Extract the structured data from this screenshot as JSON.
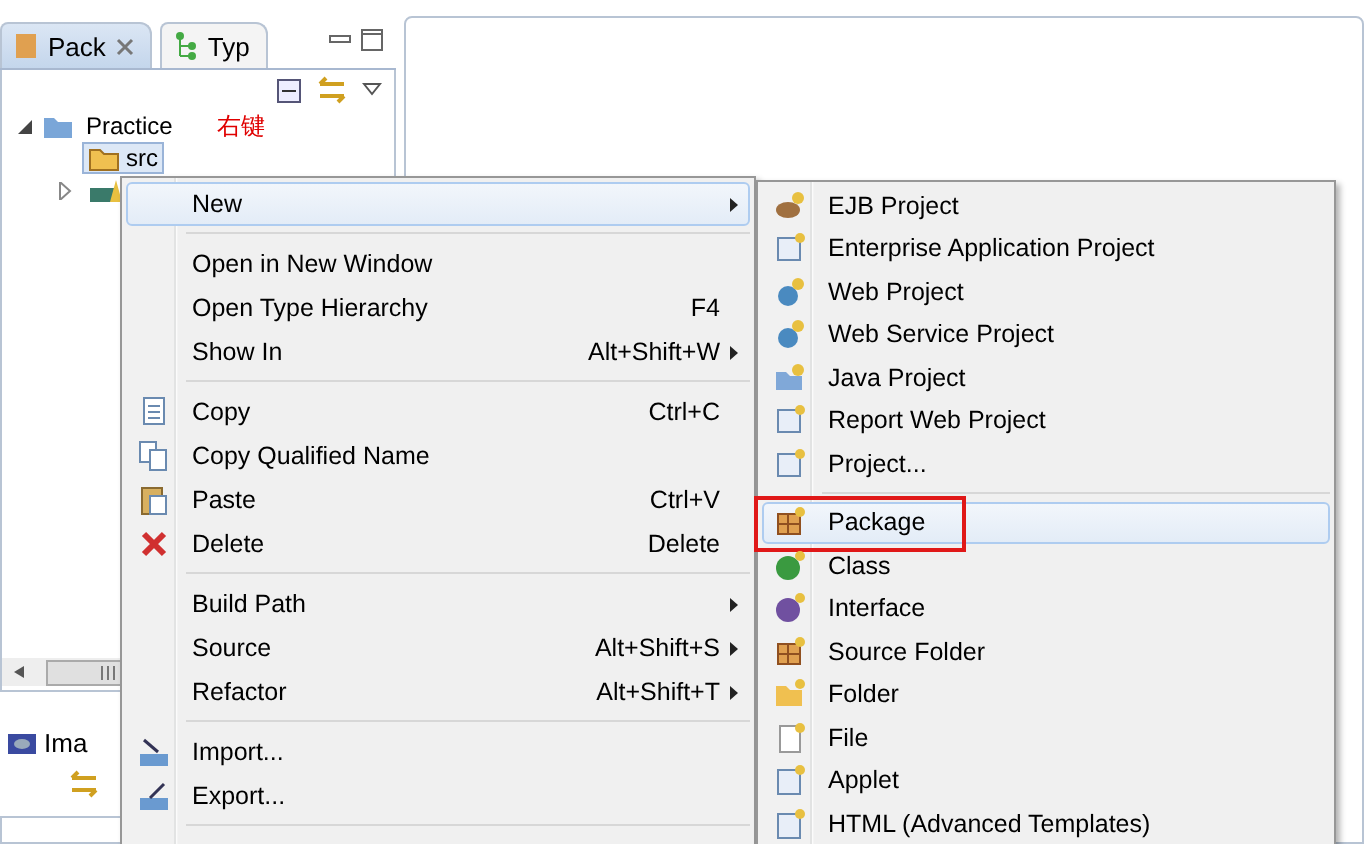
{
  "left_pane": {
    "tabs": [
      {
        "label": "Pack",
        "selected": true,
        "closable": true
      },
      {
        "label": "Typ",
        "selected": false,
        "closable": false
      }
    ],
    "tree": [
      {
        "label": "Practice",
        "expanded": true,
        "note": "右键",
        "children": [
          {
            "label": "src",
            "selected": true
          },
          {
            "selected": false,
            "expandable": true
          }
        ]
      }
    ]
  },
  "lower_pane": {
    "tab": "Ima"
  },
  "context_menu": {
    "groups": [
      [
        {
          "label": "New",
          "submenu": true,
          "selected": true
        }
      ],
      [
        {
          "label": "Open in New Window",
          "submenu": false,
          "selected": false
        },
        {
          "label": "Open Type Hierarchy",
          "shortcut": "F4",
          "submenu": false,
          "selected": false
        },
        {
          "label": "Show In",
          "shortcut": "Alt+Shift+W",
          "submenu": true,
          "selected": false
        }
      ],
      [
        {
          "label": "Copy",
          "shortcut": "Ctrl+C",
          "submenu": false,
          "selected": false
        },
        {
          "label": "Copy Qualified Name",
          "submenu": false,
          "selected": false
        },
        {
          "label": "Paste",
          "shortcut": "Ctrl+V",
          "submenu": false,
          "selected": false
        },
        {
          "label": "Delete",
          "shortcut": "Delete",
          "submenu": false,
          "selected": false
        }
      ],
      [
        {
          "label": "Build Path",
          "submenu": true,
          "selected": false
        },
        {
          "label": "Source",
          "shortcut": "Alt+Shift+S",
          "submenu": true,
          "selected": false
        },
        {
          "label": "Refactor",
          "shortcut": "Alt+Shift+T",
          "submenu": true,
          "selected": false
        }
      ],
      [
        {
          "label": "Import...",
          "submenu": false,
          "selected": false
        },
        {
          "label": "Export...",
          "submenu": false,
          "selected": false
        }
      ]
    ]
  },
  "new_submenu": {
    "groups": [
      [
        {
          "label": "EJB Project",
          "selected": false,
          "outlined": false
        },
        {
          "label": "Enterprise Application Project",
          "selected": false,
          "outlined": false
        },
        {
          "label": "Web Project",
          "selected": false,
          "outlined": false
        },
        {
          "label": "Web Service Project",
          "selected": false,
          "outlined": false
        },
        {
          "label": "Java Project",
          "selected": false,
          "outlined": false
        },
        {
          "label": "Report Web Project",
          "selected": false,
          "outlined": false
        },
        {
          "label": "Project...",
          "selected": false,
          "outlined": false
        }
      ],
      [
        {
          "label": "Package",
          "selected": true,
          "outlined": true
        },
        {
          "label": "Class",
          "selected": false,
          "outlined": false
        },
        {
          "label": "Interface",
          "selected": false,
          "outlined": false
        },
        {
          "label": "Source Folder",
          "selected": false,
          "outlined": false
        },
        {
          "label": "Folder",
          "selected": false,
          "outlined": false
        },
        {
          "label": "File",
          "selected": false,
          "outlined": false
        },
        {
          "label": "Applet",
          "selected": false,
          "outlined": false
        },
        {
          "label": "HTML (Advanced Templates)",
          "selected": false,
          "outlined": false
        }
      ]
    ]
  }
}
